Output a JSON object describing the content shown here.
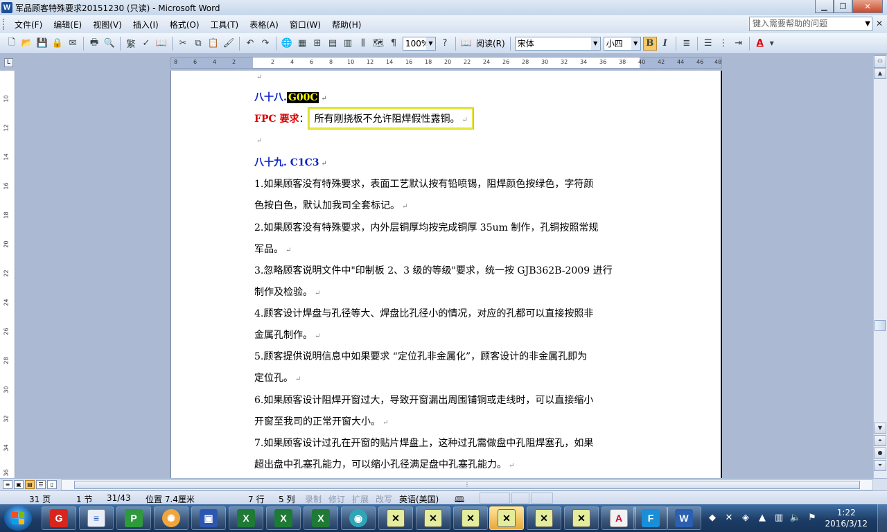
{
  "window": {
    "title": "军品顾客特殊要求20151230 (只读) - Microsoft Word",
    "app_icon": "W"
  },
  "menu": {
    "items": [
      "文件(F)",
      "编辑(E)",
      "视图(V)",
      "插入(I)",
      "格式(O)",
      "工具(T)",
      "表格(A)",
      "窗口(W)",
      "帮助(H)"
    ],
    "help_placeholder": "键入需要帮助的问题"
  },
  "toolbar": {
    "zoom": "100%",
    "read_label": "阅读(R)",
    "font": "宋体",
    "font_size": "小四",
    "bold": "B",
    "italic": "I",
    "font_color": "A"
  },
  "ruler": {
    "corner": "L",
    "h_ticks": [
      "8",
      "6",
      "4",
      "2",
      "2",
      "4",
      "6",
      "8",
      "10",
      "12",
      "14",
      "16",
      "18",
      "20",
      "22",
      "24",
      "26",
      "28",
      "30",
      "32",
      "34",
      "36",
      "38",
      "40",
      "42",
      "44",
      "46",
      "48"
    ],
    "v_ticks": [
      "10",
      "12",
      "14",
      "16",
      "18",
      "20",
      "22",
      "24",
      "26",
      "28",
      "30",
      "32",
      "34",
      "36"
    ]
  },
  "document": {
    "mark": "↵",
    "h88_prefix": "八十八.",
    "h88_code": "G00C",
    "fpc_label": "FPC 要求",
    "fpc_colon": "：",
    "fpc_text": "所有刚挠板不允许阻焊假性露铜。",
    "h89": "八十九. C1C3",
    "lines": [
      "1.如果顾客没有特殊要求，表面工艺默认按有铅喷锡，阻焊颜色按绿色，字符颜",
      "色按白色，默认加我司全套标记。",
      "2.如果顾客没有特殊要求，内外层铜厚均按完成铜厚 35um 制作，孔铜按照常规",
      "军品。",
      "3.忽略顾客说明文件中\"印制板 2、3 级的等级\"要求，统一按 GJB362B-2009 进行",
      "制作及检验。",
      "4.顾客设计焊盘与孔径等大、焊盘比孔径小的情况，对应的孔都可以直接按照非",
      "金属孔制作。",
      "5.顾客提供说明信息中如果要求 “定位孔非金属化”，顾客设计的非金属孔即为",
      "定位孔。",
      "6.如果顾客设计阻焊开窗过大，导致开窗漏出周围铺铜或走线时，可以直接缩小",
      "开窗至我司的正常开窗大小。",
      "7.如果顾客设计过孔在开窗的贴片焊盘上，这种过孔需做盘中孔阻焊塞孔，如果",
      "超出盘中孔塞孔能力，可以缩小孔径满足盘中孔塞孔能力。"
    ]
  },
  "status": {
    "page": "31 页",
    "section": "1 节",
    "page_of": "31/43",
    "position": "位置 7.4厘米",
    "line": "7 行",
    "col": "5 列",
    "rec": "录制",
    "trk": "修订",
    "ext": "扩展",
    "ovr": "改写",
    "lang": "英语(美国)"
  },
  "taskbar": {
    "clock_time": "1:22",
    "clock_date": "2016/3/12"
  },
  "colors": {
    "heading_blue": "#0b23c8",
    "fpc_red": "#d60000",
    "highlight_yellow": "#ffff00",
    "box_yellow": "#e6e63a"
  }
}
